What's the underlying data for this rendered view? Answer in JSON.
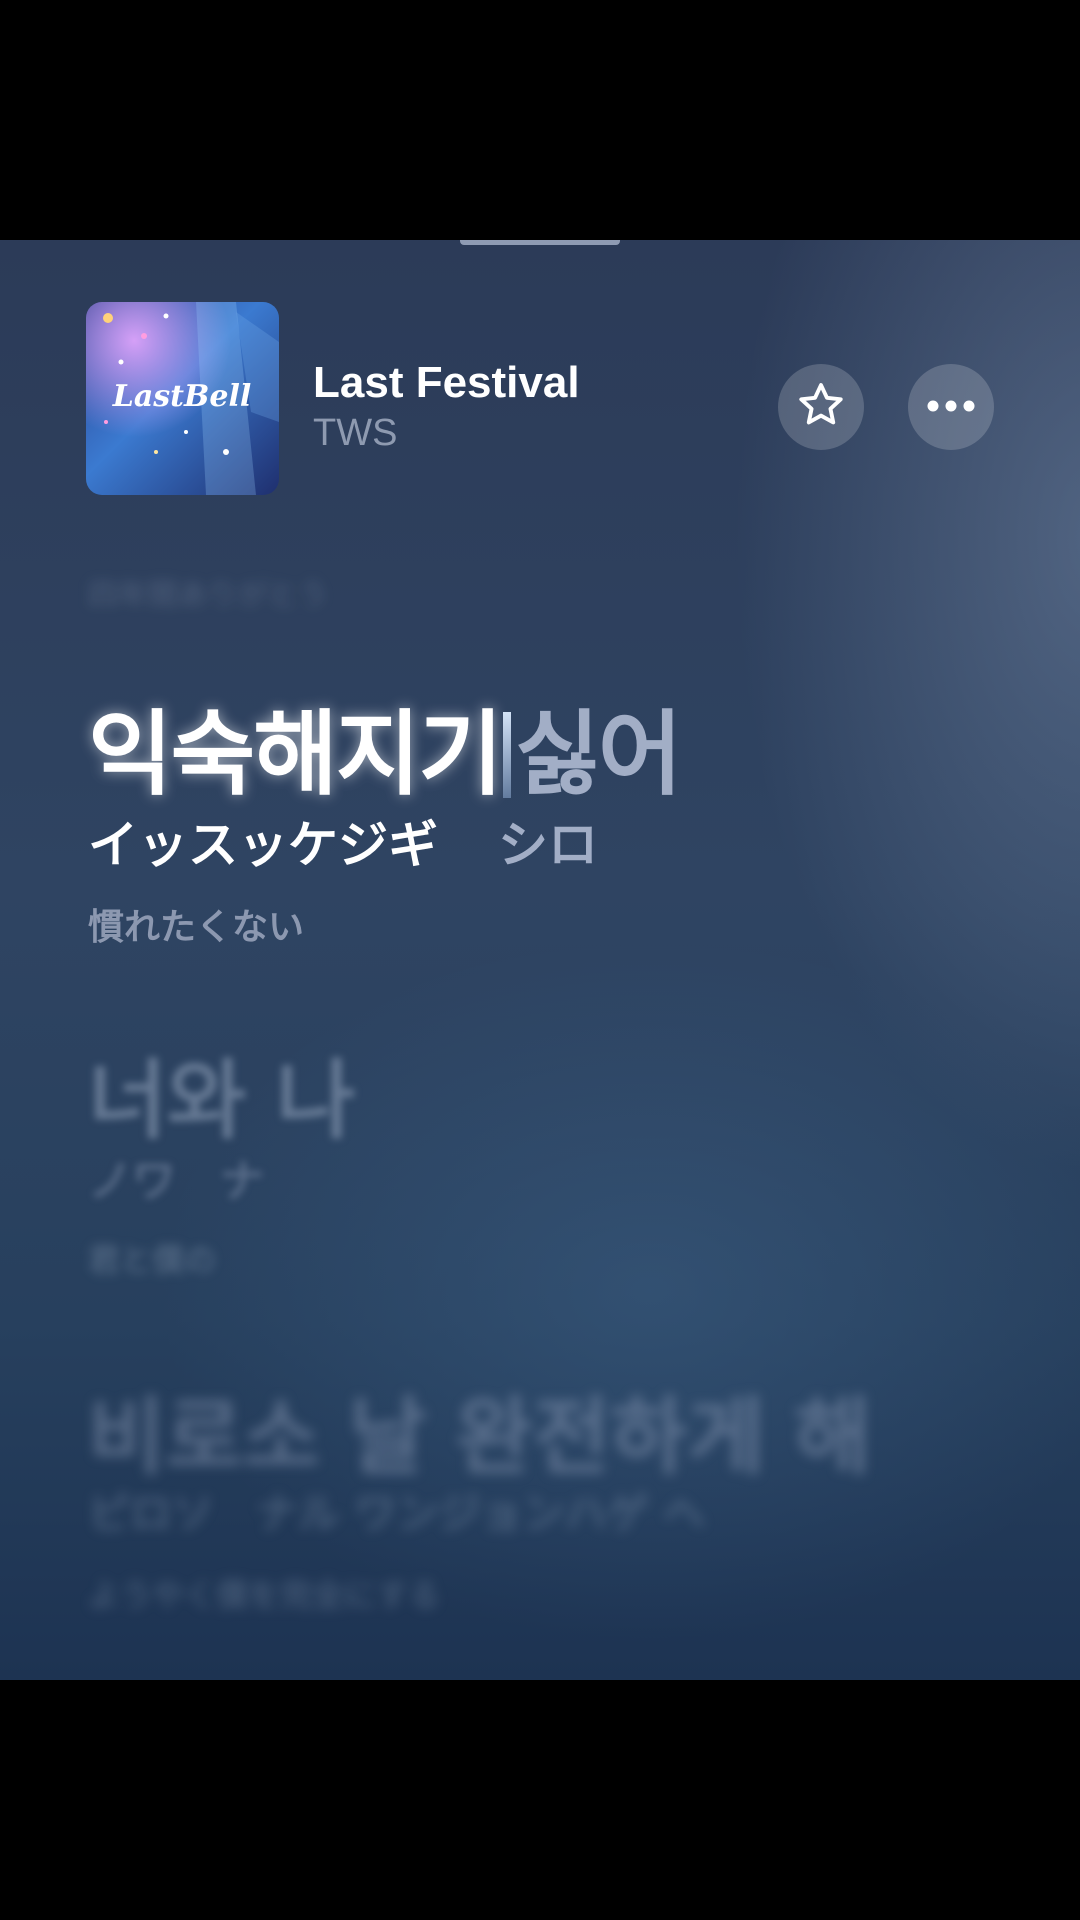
{
  "now_playing": {
    "title": "Last Festival",
    "artist": "TWS",
    "artwork_text": "LastBell",
    "actions": {
      "favorite_icon": "star-outline-icon",
      "more_icon": "ellipsis-icon"
    }
  },
  "lyrics": {
    "previous": {
      "translation": "四年間ありがとう"
    },
    "active": {
      "main_sung": "익숙해지기",
      "main_unsung": "싫어",
      "reading_sung": "イッスッケジギ",
      "reading_unsung": "シロ",
      "translation": "慣れたくない"
    },
    "next": {
      "main": "너와 나",
      "reading": "ノワ　ナ",
      "translation": "君と僕の"
    },
    "later": {
      "main": "비로소 날  완전하게  해",
      "reading": "ピロソ　ナル ワンジョンハゲ ヘ",
      "translation": "ようやく僕を完全にする"
    }
  },
  "colors": {
    "background_top": "#2c3b58",
    "background_bottom": "#1d3352",
    "lyric_active": "#ffffff",
    "lyric_upcoming": "#a2aec6",
    "artist_text": "#8e9ab0"
  }
}
